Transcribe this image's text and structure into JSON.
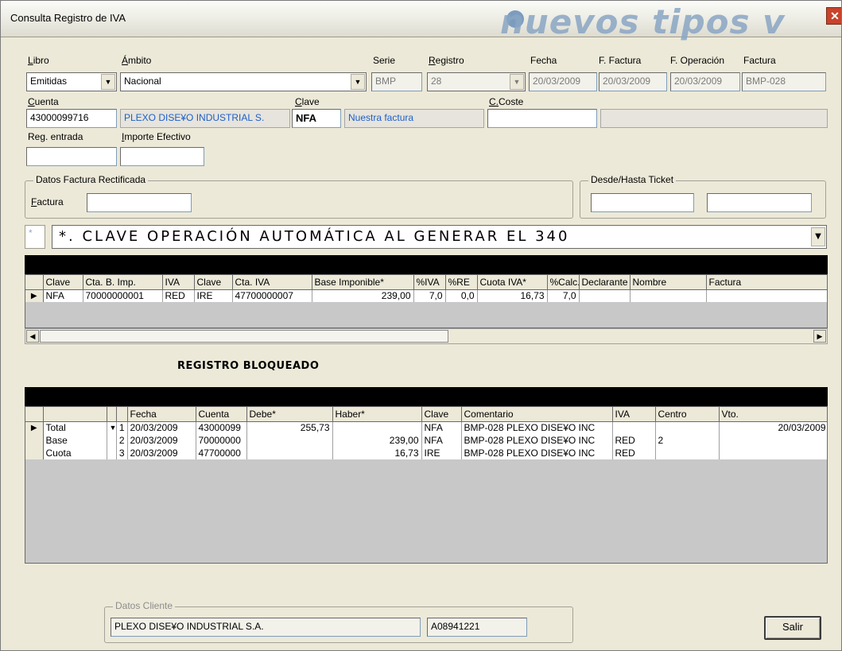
{
  "window": {
    "title": "Consulta Registro de IVA",
    "brand": "nuevos tipos v",
    "close_glyph": "✕"
  },
  "header": {
    "libro": {
      "label": "Libro",
      "value": "Emitidas"
    },
    "ambito": {
      "label": "Ámbito",
      "value": "Nacional"
    },
    "serie": {
      "label": "Serie",
      "value": "BMP"
    },
    "registro": {
      "label": "Registro",
      "value": "28"
    },
    "fecha": {
      "label": "Fecha",
      "value": "20/03/2009"
    },
    "f_factura": {
      "label": "F. Factura",
      "value": "20/03/2009"
    },
    "f_operacion": {
      "label": "F. Operación",
      "value": "20/03/2009"
    },
    "factura": {
      "label": "Factura",
      "value": "BMP-028"
    },
    "cuenta": {
      "label": "Cuenta",
      "value": "43000099716",
      "name": "PLEXO DISE¥O INDUSTRIAL S."
    },
    "clave": {
      "label": "Clave",
      "value": "NFA",
      "description": "Nuestra factura"
    },
    "c_coste": {
      "label": "C.Coste",
      "value": "",
      "description": ""
    },
    "reg_entrada": {
      "label": "Reg. entrada",
      "value": ""
    },
    "importe_efectivo": {
      "label": "Importe Efectivo",
      "value": ""
    }
  },
  "rectificada": {
    "group_label": "Datos Factura Rectificada",
    "factura_label": "Factura",
    "factura_value": ""
  },
  "ticket": {
    "group_label": "Desde/Hasta Ticket",
    "desde": "",
    "hasta": ""
  },
  "operacion": {
    "code": "*",
    "value": "*.   CLAVE OPERACIÓN AUTOMÁTICA AL GENERAR EL 340",
    "prefix": ""
  },
  "iva_grid": {
    "columns": [
      "Clave",
      "Cta. B. Imp.",
      "IVA",
      "Clave",
      "Cta. IVA",
      "Base Imponible*",
      "%IVA",
      "%RE",
      "Cuota IVA*",
      "%Calc.",
      "Declarante",
      "Nombre",
      "Factura"
    ],
    "rows": [
      [
        "NFA",
        "70000000001",
        "RED",
        "IRE",
        "47700000007",
        "239,00",
        "7,0",
        "0,0",
        "16,73",
        "7,0",
        "",
        "",
        ""
      ]
    ]
  },
  "status": {
    "locked": "REGISTRO BLOQUEADO"
  },
  "asiento_grid": {
    "columns": [
      "",
      "",
      "Fecha",
      "Cuenta",
      "Debe*",
      "Haber*",
      "Clave",
      "Comentario",
      "IVA",
      "Centro",
      "Vto."
    ],
    "rows": [
      [
        "Total",
        "1",
        "20/03/2009",
        "43000099",
        "255,73",
        "",
        "NFA",
        "BMP-028 PLEXO DISE¥O INC",
        "",
        "",
        "20/03/2009"
      ],
      [
        "Base",
        "2",
        "20/03/2009",
        "70000000",
        "",
        "239,00",
        "NFA",
        "BMP-028 PLEXO DISE¥O INC",
        "RED",
        "2",
        ""
      ],
      [
        "Cuota",
        "3",
        "20/03/2009",
        "47700000",
        "",
        "16,73",
        "IRE",
        "BMP-028 PLEXO DISE¥O INC",
        "RED",
        "",
        ""
      ]
    ]
  },
  "cliente": {
    "group_label": "Datos Cliente",
    "nombre": "PLEXO DISE¥O INDUSTRIAL S.A.",
    "nif": "A08941221"
  },
  "buttons": {
    "salir": "Salir"
  },
  "icons": {
    "dropdown": "▼",
    "left": "◀",
    "right": "▶",
    "row_pointer": "▶"
  }
}
